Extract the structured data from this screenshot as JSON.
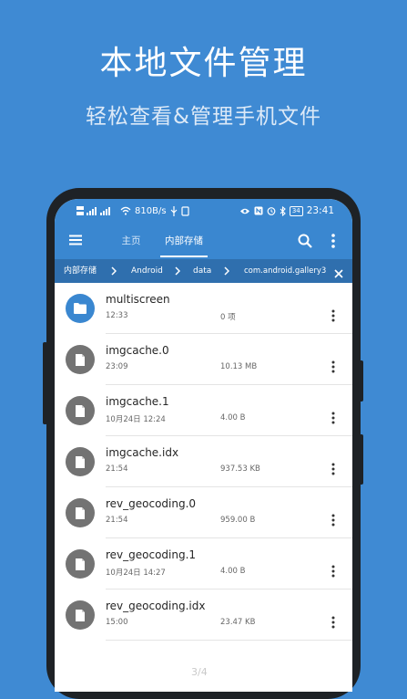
{
  "promo": {
    "title": "本地文件管理",
    "subtitle": "轻松查看&管理手机文件"
  },
  "status_bar": {
    "network_speed": "810B/s",
    "battery": "34",
    "time": "23:41"
  },
  "app_bar": {
    "tabs": [
      {
        "label": "主页",
        "active": false
      },
      {
        "label": "内部存储",
        "active": true
      }
    ]
  },
  "path_bar": {
    "crumbs": [
      "内部存储",
      "Android",
      "data",
      "com.android.gallery3"
    ]
  },
  "files": [
    {
      "name": "multiscreen",
      "date": "12:33",
      "size": "0 项",
      "type": "folder"
    },
    {
      "name": "imgcache.0",
      "date": "23:09",
      "size": "10.13 MB",
      "type": "file"
    },
    {
      "name": "imgcache.1",
      "date": "10月24日 12:24",
      "size": "4.00 B",
      "type": "file"
    },
    {
      "name": "imgcache.idx",
      "date": "21:54",
      "size": "937.53 KB",
      "type": "file"
    },
    {
      "name": "rev_geocoding.0",
      "date": "21:54",
      "size": "959.00 B",
      "type": "file"
    },
    {
      "name": "rev_geocoding.1",
      "date": "10月24日 14:27",
      "size": "4.00 B",
      "type": "file"
    },
    {
      "name": "rev_geocoding.idx",
      "date": "15:00",
      "size": "23.47 KB",
      "type": "file"
    }
  ],
  "page_indicator": "3/4",
  "colors": {
    "background": "#3f8ad3",
    "app_bar": "#3a87d0",
    "path_bar": "#2f6fae",
    "folder_icon": "#3a87d0",
    "file_icon": "#737373"
  }
}
